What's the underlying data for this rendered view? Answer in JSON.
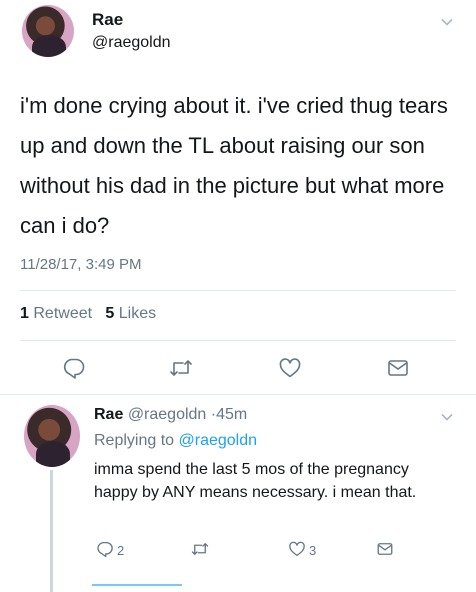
{
  "main_tweet": {
    "display_name": "Rae",
    "handle": "@raegoldn",
    "text": "i'm done crying about it.  i've cried thug tears up and down the TL about raising our son without his dad in the picture but what more can i do?",
    "timestamp": "11/28/17, 3:49 PM",
    "retweet_count": "1",
    "retweet_label": "Retweet",
    "like_count": "5",
    "like_label": "Likes"
  },
  "reply_tweet": {
    "display_name": "Rae",
    "handle": "@raegoldn",
    "dot": "·",
    "age": "45m",
    "replying_prefix": "Replying to",
    "replying_to": "@raegoldn",
    "text": "imma spend the last 5 mos of the pregnancy happy by ANY means necessary.  i mean that.",
    "reply_count": "2",
    "like_count": "3"
  },
  "icons": {
    "reply": "reply-icon",
    "retweet": "retweet-icon",
    "like": "heart-icon",
    "dm": "envelope-icon",
    "menu": "chevron-down-icon"
  },
  "colors": {
    "link": "#1da1f2",
    "secondary_text": "#657786",
    "divider": "#e1e8ed"
  }
}
